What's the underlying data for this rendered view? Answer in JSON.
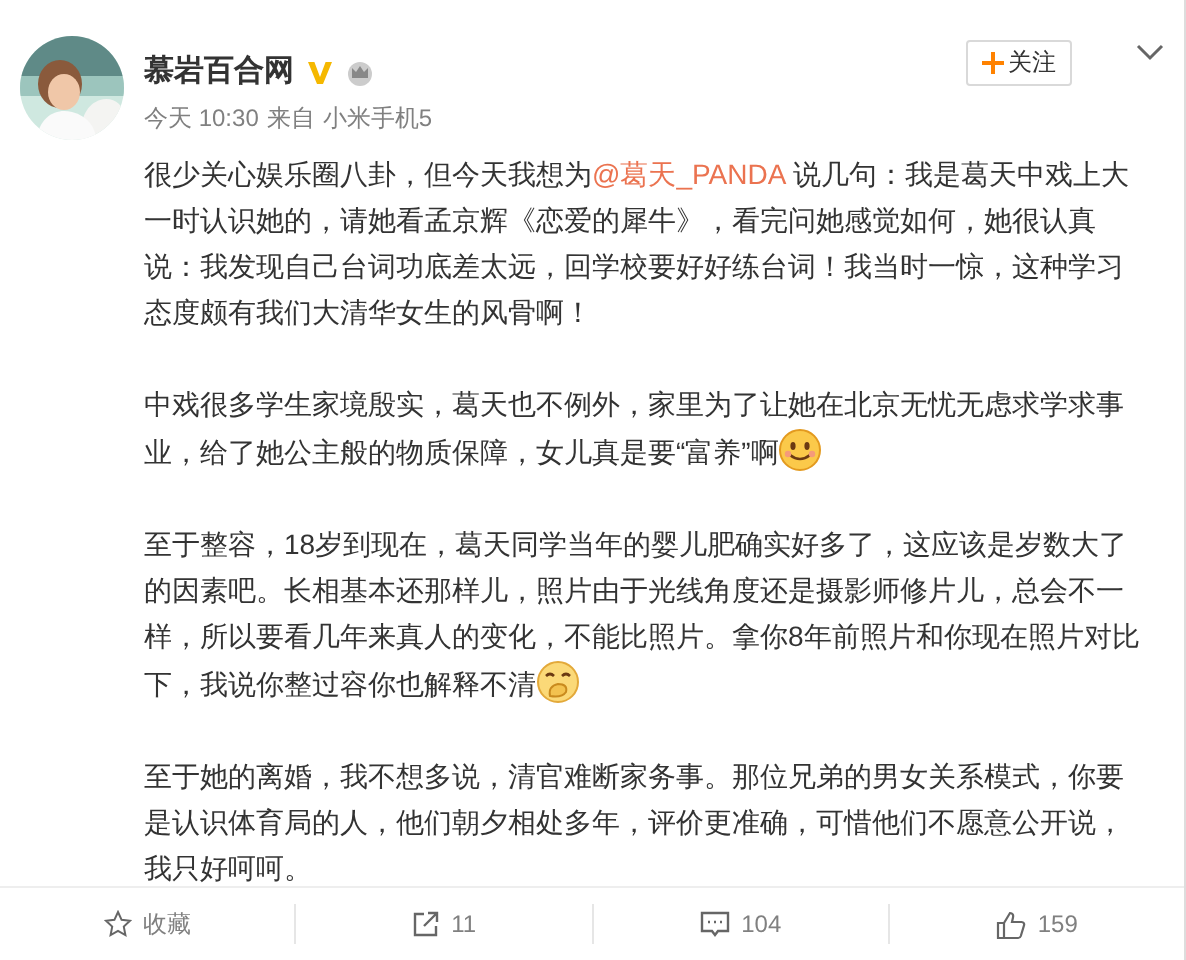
{
  "author": {
    "name": "慕岩百合网",
    "verified": true,
    "time": "今天 10:30",
    "source_prefix": "来自",
    "source": "小米手机5"
  },
  "follow_button": {
    "label": "关注"
  },
  "paragraphs": [
    [
      {
        "kind": "text",
        "text": "很少关心娱乐圈八卦，但今天我想为"
      },
      {
        "kind": "mention",
        "text": "@葛天_PANDA"
      },
      {
        "kind": "text",
        "text": " 说几句：我是葛天中戏上大一时认识她的，请她看孟京辉《恋爱的犀牛》，看完问她感觉如何，她很认真说：我发现自己台词功底差太远，回学校要好好练台词！我当时一惊，这种学习态度颇有我们大清华女生的风骨啊！"
      }
    ],
    [
      {
        "kind": "text",
        "text": "中戏很多学生家境殷实，葛天也不例外，家里为了让她在北京无忧无虑求学求事业，给了她公主般的物质保障，女儿真是要“富养”啊"
      },
      {
        "kind": "smile"
      }
    ],
    [
      {
        "kind": "text",
        "text": "至于整容，18岁到现在，葛天同学当年的婴儿肥确实好多了，这应该是岁数大了的因素吧。长相基本还那样儿，照片由于光线角度还是摄影师修片儿，总会不一样，所以要看几年来真人的变化，不能比照片。拿你8年前照片和你现在照片对比下，我说你整过容你也解释不清"
      },
      {
        "kind": "giggle"
      }
    ],
    [
      {
        "kind": "text",
        "text": "至于她的离婚，我不想多说，清官难断家务事。那位兄弟的男女关系模式，你要是认识体育局的人，他们朝夕相处多年，评价更准确，可惜他们不愿意公开说，我只好呵呵。"
      }
    ]
  ],
  "actions": [
    {
      "kind": "favorite",
      "label": "收藏"
    },
    {
      "kind": "repost",
      "label": "11"
    },
    {
      "kind": "comment",
      "label": "104"
    },
    {
      "kind": "like",
      "label": "159"
    }
  ]
}
